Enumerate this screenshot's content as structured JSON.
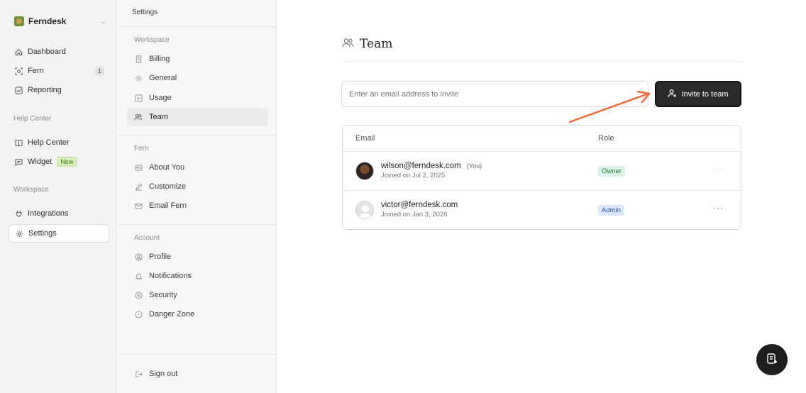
{
  "workspace": {
    "name": "Ferndesk"
  },
  "leftnav": {
    "items": [
      {
        "label": "Dashboard"
      },
      {
        "label": "Fern",
        "count": "1"
      },
      {
        "label": "Reporting"
      }
    ],
    "help_center_heading": "Help Center",
    "help_items": [
      {
        "label": "Help Center"
      },
      {
        "label": "Widget",
        "badge": "New"
      }
    ],
    "workspace_heading": "Workspace",
    "workspace_items": [
      {
        "label": "Integrations"
      },
      {
        "label": "Settings"
      }
    ]
  },
  "settings": {
    "title": "Settings",
    "workspace_heading": "Workspace",
    "workspace_items": [
      {
        "label": "Billing"
      },
      {
        "label": "General"
      },
      {
        "label": "Usage"
      },
      {
        "label": "Team"
      }
    ],
    "fern_heading": "Fern",
    "fern_items": [
      {
        "label": "About You"
      },
      {
        "label": "Customize"
      },
      {
        "label": "Email Fern"
      }
    ],
    "account_heading": "Account",
    "account_items": [
      {
        "label": "Profile"
      },
      {
        "label": "Notifications"
      },
      {
        "label": "Security"
      },
      {
        "label": "Danger Zone"
      }
    ],
    "sign_out": "Sign out"
  },
  "main": {
    "title": "Team",
    "invite": {
      "placeholder": "Enter an email address to invite",
      "button_label": "Invite to team"
    },
    "table": {
      "headers": {
        "email": "Email",
        "role": "Role"
      },
      "rows": [
        {
          "email": "wilson@ferndesk.com",
          "tag": "(You)",
          "joined": "Joined on Jul 2, 2025",
          "role": "Owner"
        },
        {
          "email": "victor@ferndesk.com",
          "tag": "",
          "joined": "Joined on Jan 3, 2026",
          "role": "Admin"
        }
      ]
    }
  },
  "colors": {
    "arrow": "#f06a35",
    "owner_badge": "#daf2e3",
    "admin_badge": "#dde7fb",
    "primary_button": "#2b2b2b"
  }
}
